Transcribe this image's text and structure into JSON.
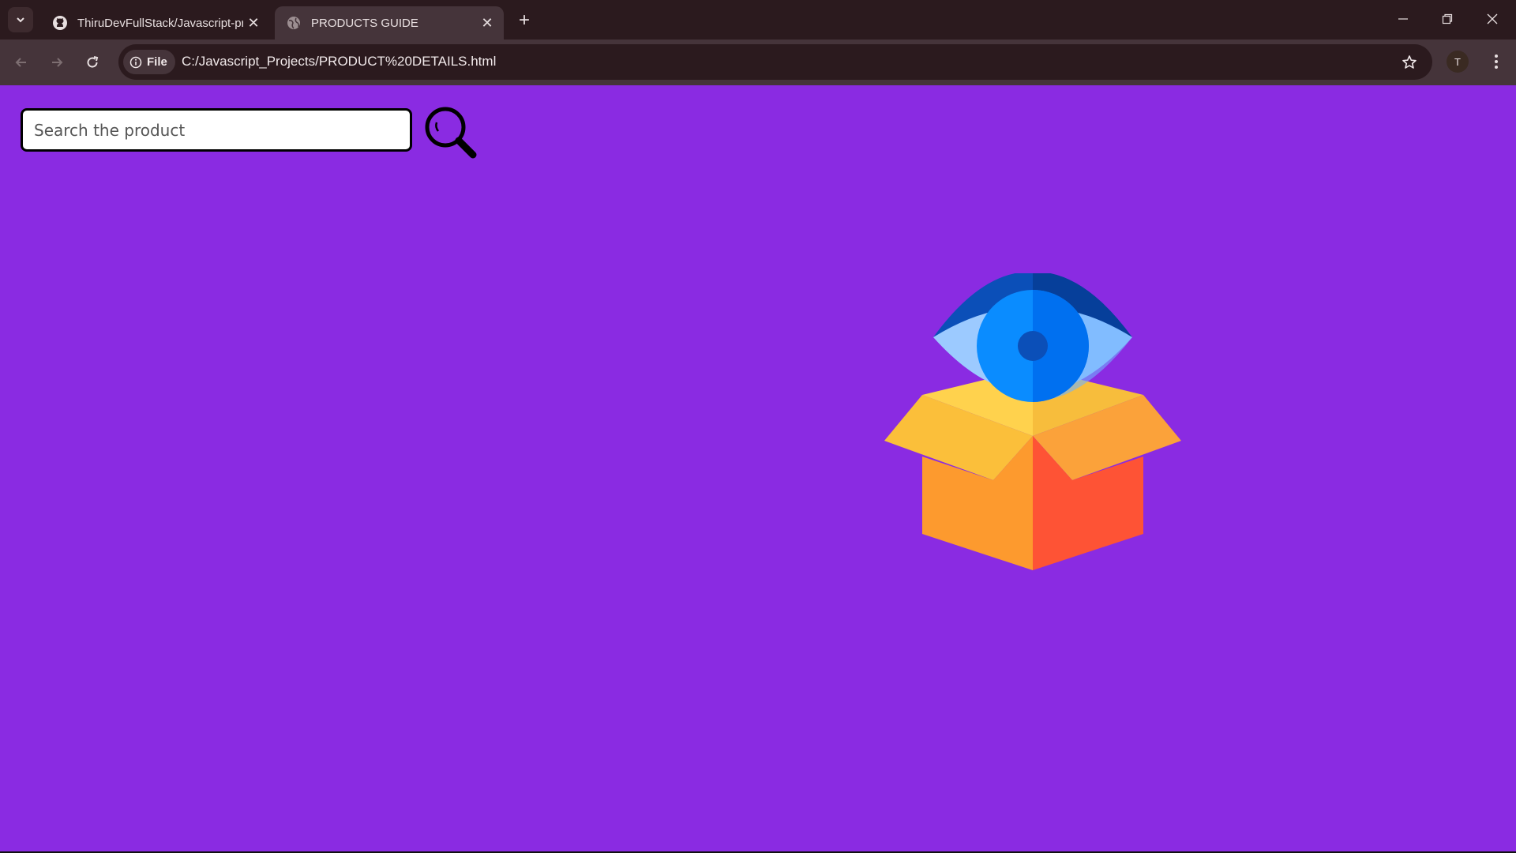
{
  "browser": {
    "tabs": [
      {
        "title": "ThiruDevFullStack/Javascript-pr",
        "favicon": "github-icon",
        "active": false
      },
      {
        "title": "PRODUCTS GUIDE",
        "favicon": "globe-icon",
        "active": true
      }
    ],
    "address": {
      "chip_label": "File",
      "url": "C:/Javascript_Projects/PRODUCT%20DETAILS.html"
    },
    "profile_initial": "T"
  },
  "page": {
    "background": "#8a2be2",
    "search": {
      "placeholder": "Search the product",
      "value": ""
    },
    "illustration": "eye-over-open-box-icon"
  }
}
